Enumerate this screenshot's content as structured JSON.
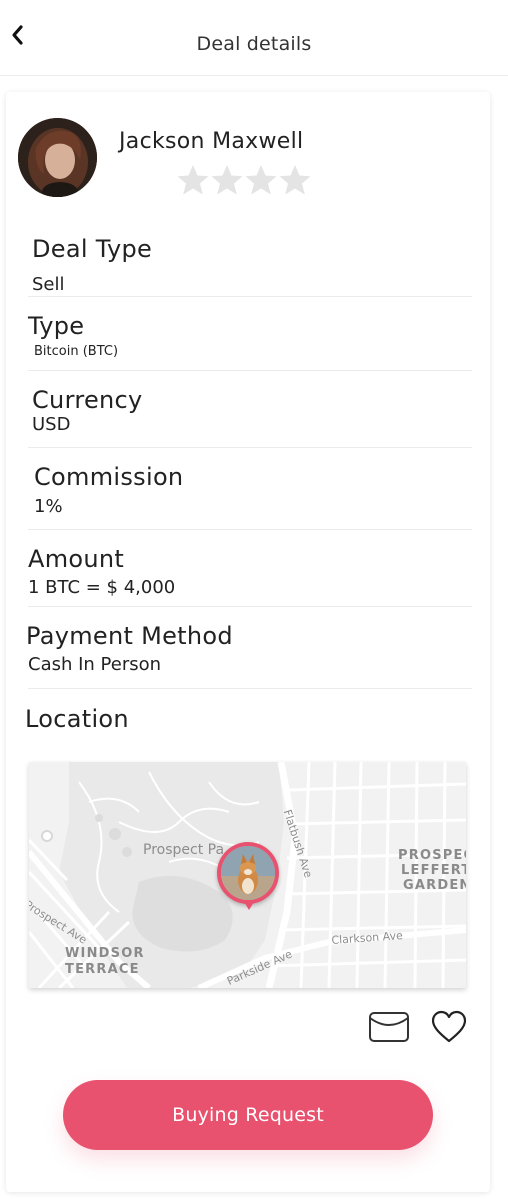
{
  "header": {
    "title": "Deal details",
    "back_icon": "chevron-left-icon"
  },
  "user": {
    "name": "Jackson Maxwell",
    "rating": 0,
    "rating_max": 4
  },
  "details": {
    "deal_type_label": "Deal Type",
    "deal_type_value": "Sell",
    "type_label": "Type",
    "type_value": "Bitcoin (BTC)",
    "currency_label": "Currency",
    "currency_value": "USD",
    "commission_label": "Commission",
    "commission_value": "1%",
    "amount_label": "Amount",
    "amount_value": "1 BTC = $ 4,000",
    "payment_label": "Payment Method",
    "payment_value": "Cash In Person",
    "location_label": "Location"
  },
  "map": {
    "labels": {
      "prospect_park": "Prospect Pa",
      "prospect_ave": "Prospect Ave",
      "windsor_1": "WINDSOR",
      "windsor_2": "TERRACE",
      "flatbush": "Flatbush Ave",
      "parkside": "Parkside Ave",
      "clarkson": "Clarkson Ave",
      "lefferts_1": "PROSPEC",
      "lefferts_2": "LEFFERT",
      "lefferts_3": "GARDEN"
    }
  },
  "actions": {
    "message_icon": "envelope-icon",
    "favorite_icon": "heart-icon",
    "cta_label": "Buying Request"
  },
  "colors": {
    "accent": "#e8526e",
    "star_empty": "#e4e4e4"
  }
}
